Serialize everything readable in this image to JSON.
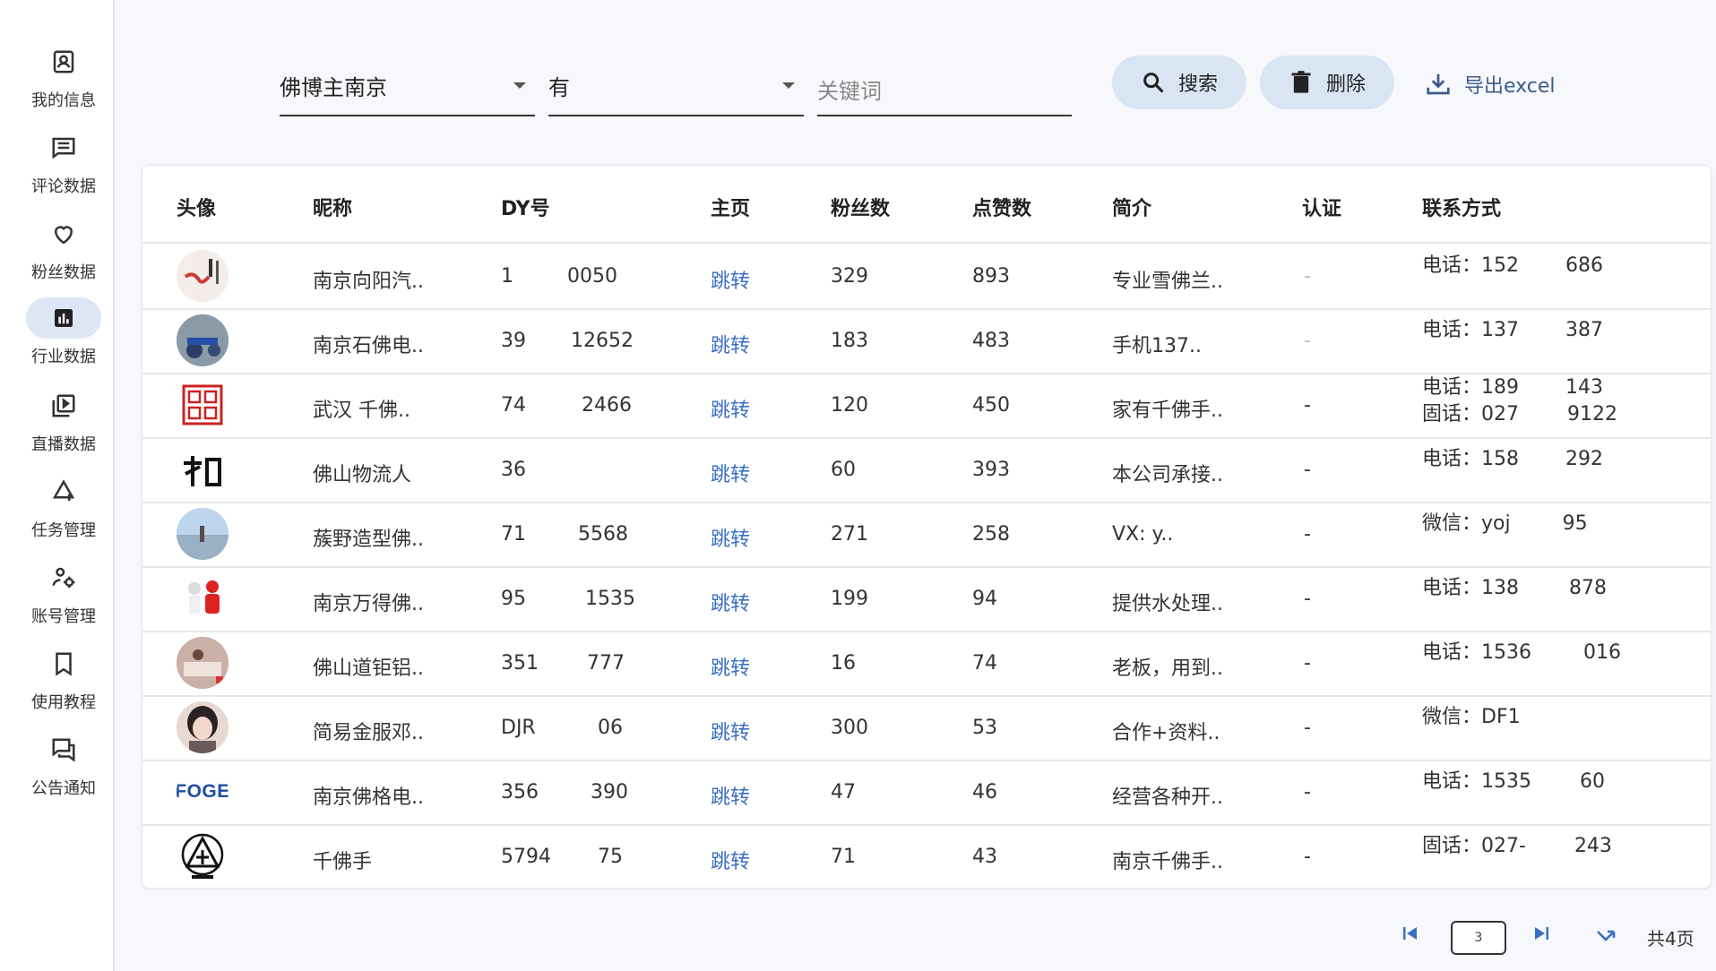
{
  "sidebar": {
    "items": [
      {
        "label": "我的信息",
        "icon": "contact-card-icon",
        "active": false
      },
      {
        "label": "评论数据",
        "icon": "message-lines-icon",
        "active": false
      },
      {
        "label": "粉丝数据",
        "icon": "heart-icon",
        "active": false
      },
      {
        "label": "行业数据",
        "icon": "bar-chart-icon",
        "active": true
      },
      {
        "label": "直播数据",
        "icon": "play-video-icon",
        "active": false
      },
      {
        "label": "任务管理",
        "icon": "task-add-icon",
        "active": false
      },
      {
        "label": "账号管理",
        "icon": "user-settings-icon",
        "active": false
      },
      {
        "label": "使用教程",
        "icon": "bookmark-icon",
        "active": false
      },
      {
        "label": "公告通知",
        "icon": "forum-icon",
        "active": false
      }
    ]
  },
  "toolbar": {
    "region_value": "佛博主南京",
    "has_value": "有",
    "keyword_placeholder": "关键词",
    "search_label": "搜索",
    "delete_label": "删除",
    "export_label": "导出excel"
  },
  "table": {
    "headers": {
      "avatar": "头像",
      "nickname": "昵称",
      "dy": "DY号",
      "home": "主页",
      "fans": "粉丝数",
      "likes": "点赞数",
      "intro": "简介",
      "verify": "认证",
      "contact": "联系方式"
    },
    "rows": [
      {
        "nickname": "南京向阳汽..",
        "dy_a": "1",
        "dy_b": "0050",
        "home": "跳转",
        "fans": "329",
        "likes": "893",
        "intro": "专业雪佛兰..",
        "verify": "-",
        "contact1": "电话：152",
        "contact1b": "686",
        "contact2": "",
        "contact2b": ""
      },
      {
        "nickname": "南京石佛电..",
        "dy_a": "39",
        "dy_b": "12652",
        "home": "跳转",
        "fans": "183",
        "likes": "483",
        "intro": "手机137..",
        "verify": "-",
        "contact1": "电话：137",
        "contact1b": "387",
        "contact2": "",
        "contact2b": ""
      },
      {
        "nickname": "武汉 千佛..",
        "dy_a": "74",
        "dy_b": "2466",
        "home": "跳转",
        "fans": "120",
        "likes": "450",
        "intro": "家有千佛手..",
        "verify": "-",
        "contact1": "电话：189",
        "contact1b": "143",
        "contact2": "固话：027",
        "contact2b": "9122"
      },
      {
        "nickname": "佛山物流人",
        "dy_a": "36",
        "dy_b": "",
        "home": "跳转",
        "fans": "60",
        "likes": "393",
        "intro": "本公司承接..",
        "verify": "-",
        "contact1": "电话：158",
        "contact1b": "292",
        "contact2": "",
        "contact2b": ""
      },
      {
        "nickname": "蔟野造型佛..",
        "dy_a": "71",
        "dy_b": "5568",
        "home": "跳转",
        "fans": "271",
        "likes": "258",
        "intro": "VX: y..",
        "verify": "-",
        "contact1": "微信：yoj",
        "contact1b": "95",
        "contact2": "",
        "contact2b": ""
      },
      {
        "nickname": "南京万得佛..",
        "dy_a": "95",
        "dy_b": "1535",
        "home": "跳转",
        "fans": "199",
        "likes": "94",
        "intro": "提供水处理..",
        "verify": "-",
        "contact1": "电话：138",
        "contact1b": "878",
        "contact2": "",
        "contact2b": ""
      },
      {
        "nickname": "佛山道钜铝..",
        "dy_a": "351",
        "dy_b": "777",
        "home": "跳转",
        "fans": "16",
        "likes": "74",
        "intro": "老板，用到..",
        "verify": "-",
        "contact1": "电话：1536",
        "contact1b": "016",
        "contact2": "",
        "contact2b": ""
      },
      {
        "nickname": "简易金服邓..",
        "dy_a": "DJR",
        "dy_b": "06",
        "home": "跳转",
        "fans": "300",
        "likes": "53",
        "intro": "合作+资料..",
        "verify": "-",
        "contact1": "微信：DF1",
        "contact1b": "",
        "contact2": "",
        "contact2b": ""
      },
      {
        "nickname": "南京佛格电..",
        "dy_a": "356",
        "dy_b": "390",
        "home": "跳转",
        "fans": "47",
        "likes": "46",
        "intro": "经营各种开..",
        "verify": "-",
        "contact1": "电话：1535",
        "contact1b": "60",
        "contact2": "",
        "contact2b": ""
      },
      {
        "nickname": "千佛手",
        "dy_a": "5794",
        "dy_b": "75",
        "home": "跳转",
        "fans": "71",
        "likes": "43",
        "intro": "南京千佛手..",
        "verify": "-",
        "contact1": "固话：027-",
        "contact1b": "243",
        "contact2": "",
        "contact2b": ""
      }
    ]
  },
  "avatars": {
    "row9_text": "FOGE"
  },
  "pagination": {
    "current": "3",
    "total": "共4页"
  }
}
